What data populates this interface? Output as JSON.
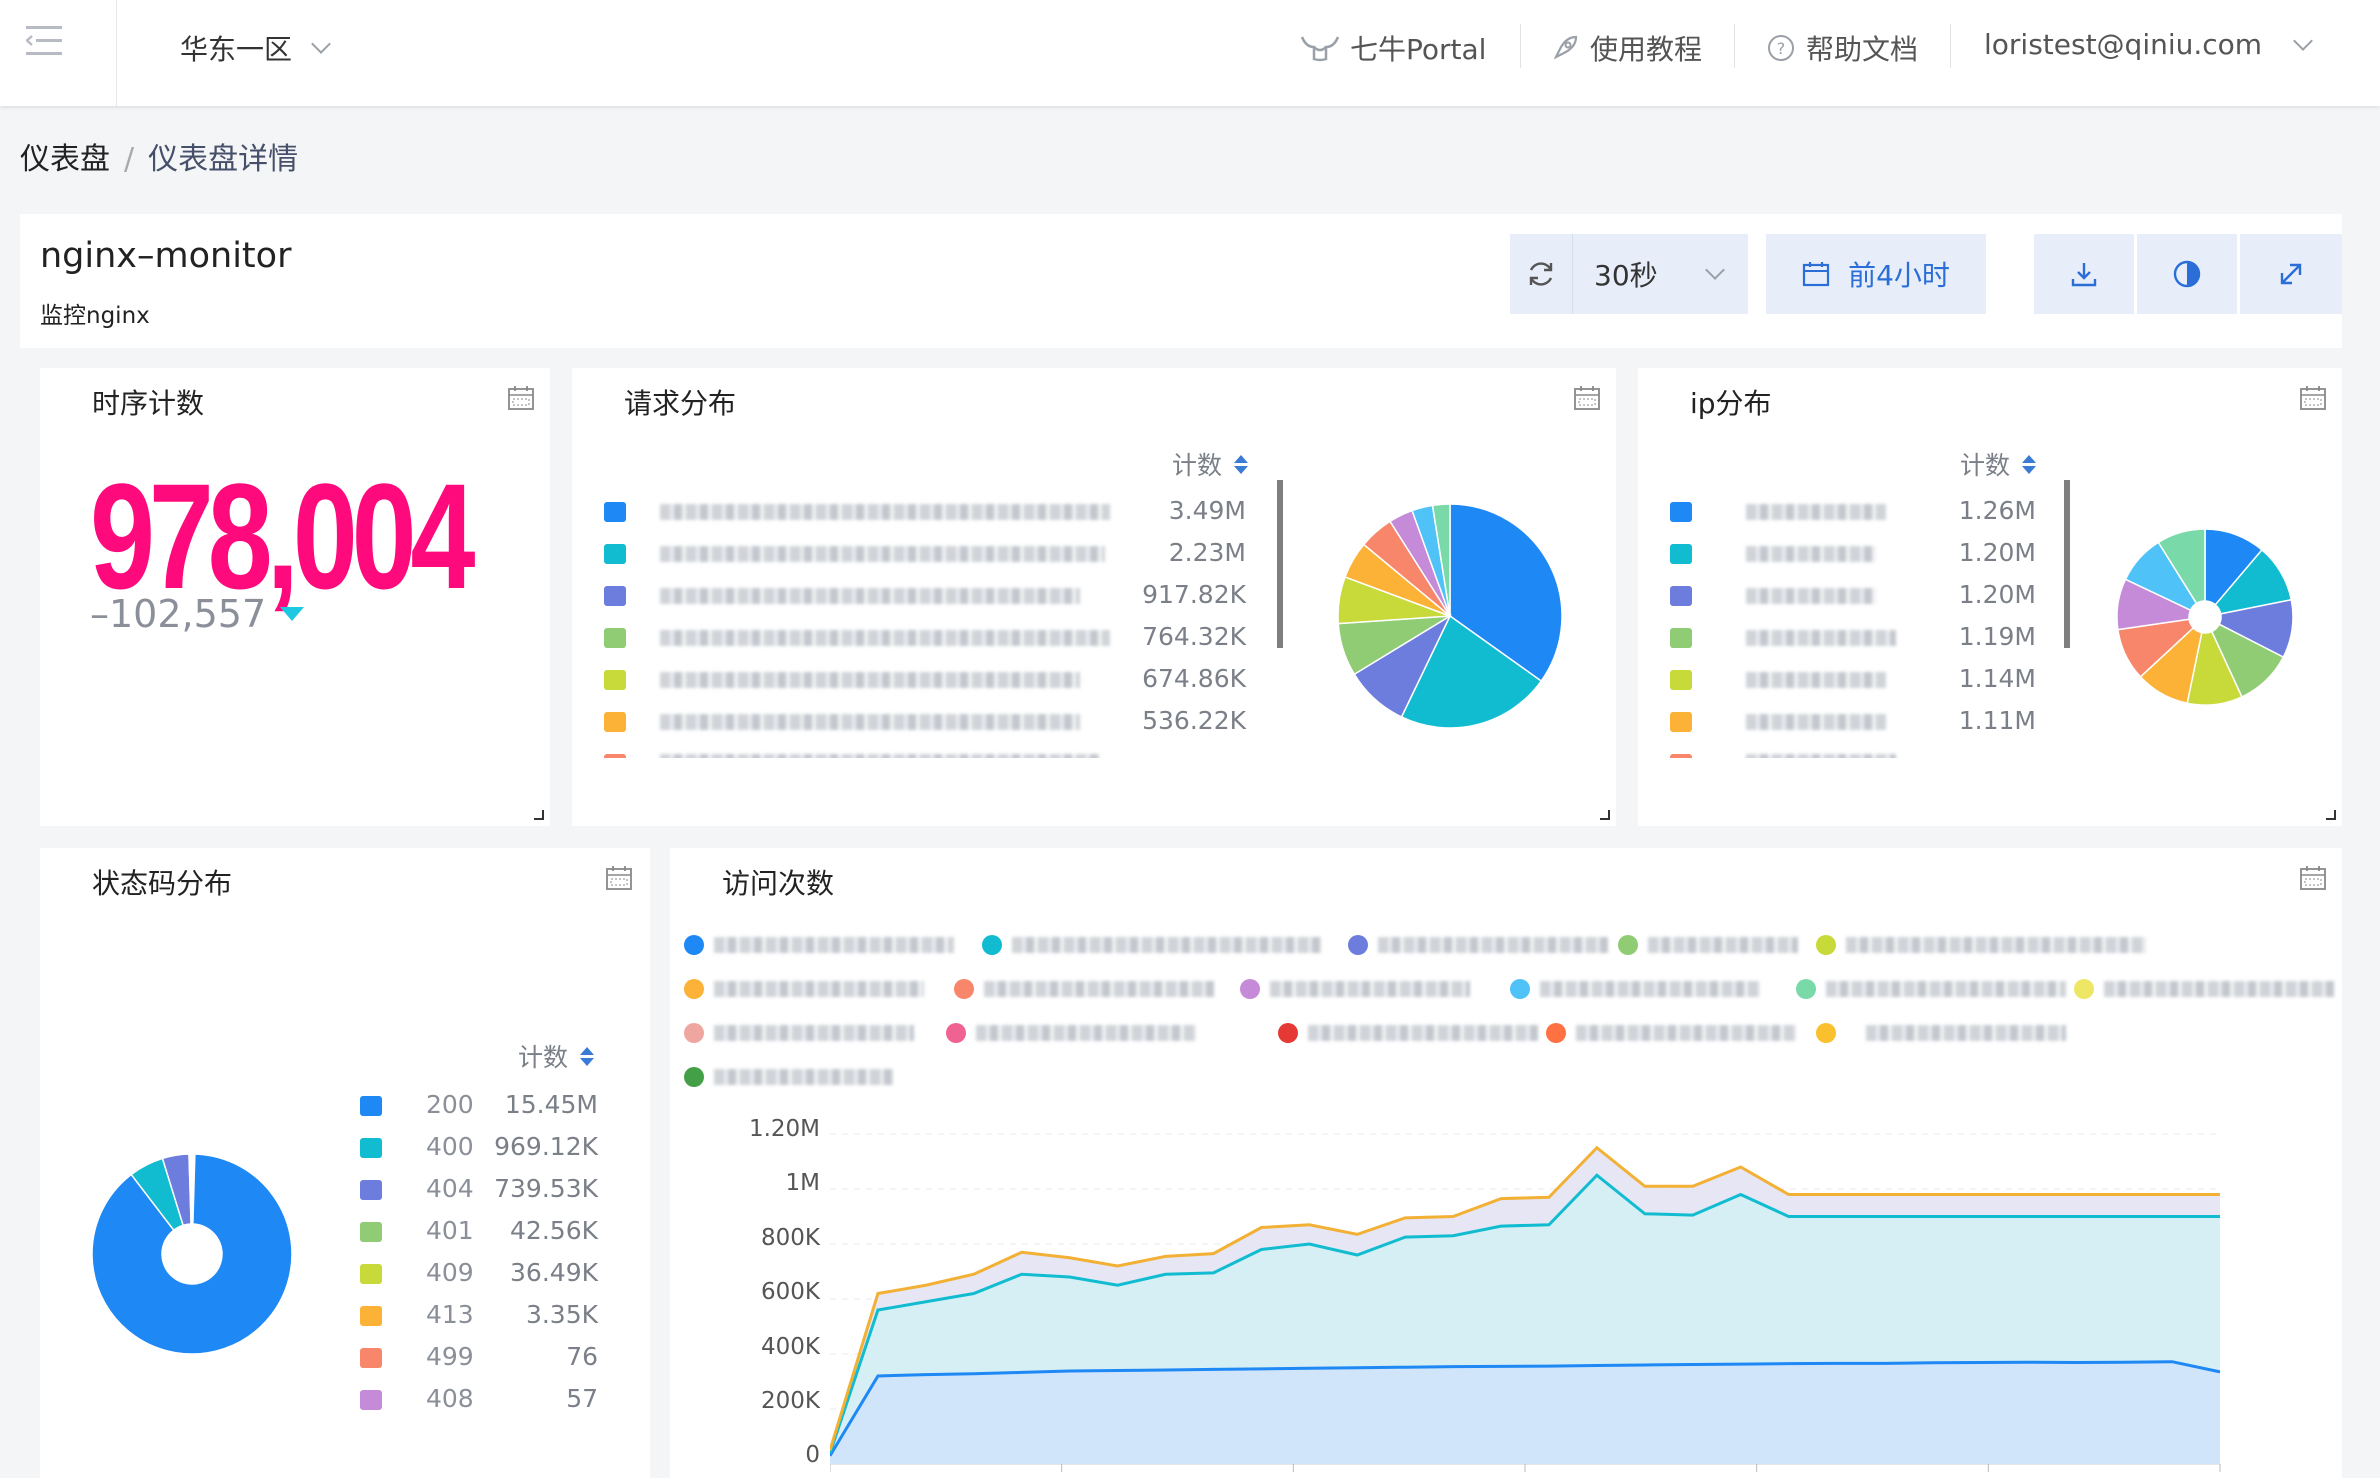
{
  "topbar": {
    "region": "华东一区",
    "portal": "七牛Portal",
    "tutorial": "使用教程",
    "help": "帮助文档",
    "user": "loristest@qiniu.com"
  },
  "breadcrumb": {
    "root": "仪表盘",
    "current": "仪表盘详情"
  },
  "dashboard": {
    "title": "nginx–monitor",
    "subtitle": "监控nginx",
    "refresh_interval": "30秒",
    "time_range": "前4小时"
  },
  "panels": {
    "timeseries_count": {
      "title": "时序计数",
      "value": "978,004",
      "delta": "–102,557",
      "trend": "down"
    },
    "request_dist": {
      "title": "请求分布",
      "count_header": "计数",
      "values": [
        "3.49M",
        "2.23M",
        "917.82K",
        "764.32K",
        "674.86K",
        "536.22K"
      ],
      "colors": [
        "#1e88f5",
        "#11bcd0",
        "#6d7ddd",
        "#8fcc74",
        "#c8d93a",
        "#fbb236"
      ]
    },
    "ip_dist": {
      "title": "ip分布",
      "count_header": "计数",
      "values": [
        "1.26M",
        "1.20M",
        "1.20M",
        "1.19M",
        "1.14M",
        "1.11M"
      ],
      "colors": [
        "#1e88f5",
        "#11bcd0",
        "#6d7ddd",
        "#8fcc74",
        "#c8d93a",
        "#fbb236"
      ]
    },
    "status_dist": {
      "title": "状态码分布",
      "count_header": "计数",
      "rows": [
        {
          "code": "200",
          "count": "15.45M",
          "color": "#1e88f5"
        },
        {
          "code": "400",
          "count": "969.12K",
          "color": "#11bcd0"
        },
        {
          "code": "404",
          "count": "739.53K",
          "color": "#6d7ddd"
        },
        {
          "code": "401",
          "count": "42.56K",
          "color": "#8fcc74"
        },
        {
          "code": "409",
          "count": "36.49K",
          "color": "#c8d93a"
        },
        {
          "code": "413",
          "count": "3.35K",
          "color": "#fbb236"
        },
        {
          "code": "499",
          "count": "76",
          "color": "#f7866a"
        },
        {
          "code": "408",
          "count": "57",
          "color": "#c58bd9"
        }
      ]
    },
    "visits": {
      "title": "访问次数",
      "y_ticks": [
        "1.20M",
        "1M",
        "800K",
        "600K",
        "400K",
        "200K",
        "0"
      ]
    }
  },
  "chart_data": [
    {
      "type": "pie",
      "title": "请求分布",
      "categories": [
        "",
        "",
        "",
        "",
        "",
        "",
        "",
        "",
        "",
        ""
      ],
      "values": [
        3.49,
        2.23,
        0.918,
        0.764,
        0.675,
        0.536,
        0.5,
        0.35,
        0.3,
        0.25
      ],
      "colors": [
        "#1e88f5",
        "#11bcd0",
        "#6d7ddd",
        "#8fcc74",
        "#c8d93a",
        "#fbb236",
        "#f7866a",
        "#c58bd9",
        "#4fc3f7",
        "#7ad9a8"
      ]
    },
    {
      "type": "pie",
      "title": "ip分布",
      "categories": [
        "",
        "",
        "",
        "",
        "",
        "",
        "",
        "",
        "",
        ""
      ],
      "values": [
        1.26,
        1.2,
        1.2,
        1.19,
        1.14,
        1.11,
        1.08,
        1.05,
        1.02,
        1.0
      ],
      "colors": [
        "#1e88f5",
        "#11bcd0",
        "#6d7ddd",
        "#8fcc74",
        "#c8d93a",
        "#fbb236",
        "#f7866a",
        "#c58bd9",
        "#4fc3f7",
        "#7ad9a8"
      ]
    },
    {
      "type": "pie",
      "title": "状态码分布",
      "categories": [
        "200",
        "400",
        "404",
        "401",
        "409",
        "413",
        "499",
        "408"
      ],
      "values": [
        15.45,
        0.969,
        0.7395,
        0.04256,
        0.03649,
        0.00335,
        7.6e-05,
        5.7e-05
      ],
      "colors": [
        "#1e88f5",
        "#11bcd0",
        "#6d7ddd",
        "#8fcc74",
        "#c8d93a",
        "#fbb236",
        "#f7866a",
        "#c58bd9"
      ]
    },
    {
      "type": "area",
      "title": "访问次数",
      "ylim": [
        0,
        1200000
      ],
      "x": [
        0,
        1,
        2,
        3,
        4,
        5,
        6,
        7,
        8,
        9,
        10,
        11,
        12,
        13,
        14,
        15,
        16,
        17,
        18,
        19,
        20,
        21,
        22,
        23,
        24,
        25,
        26,
        27,
        28,
        29
      ],
      "series": [
        {
          "color": "#1e88f5",
          "values": [
            30000,
            320000,
            325000,
            328000,
            333000,
            338000,
            340000,
            342000,
            344000,
            346000,
            348000,
            350000,
            352000,
            354000,
            355000,
            356000,
            358000,
            360000,
            362000,
            363000,
            365000,
            366000,
            366000,
            368000,
            369000,
            370000,
            369000,
            370000,
            372000,
            335000
          ]
        },
        {
          "color": "#11bcd0",
          "values": [
            40000,
            560000,
            590000,
            620000,
            690000,
            680000,
            650000,
            690000,
            695000,
            780000,
            800000,
            760000,
            825000,
            830000,
            865000,
            870000,
            1050000,
            910000,
            905000,
            980000,
            900000,
            900000,
            900000,
            900000,
            900000,
            900000,
            900000,
            900000,
            900000,
            900000
          ]
        },
        {
          "color": "#f2b035",
          "values": [
            50000,
            620000,
            650000,
            690000,
            770000,
            750000,
            720000,
            755000,
            765000,
            860000,
            870000,
            835000,
            895000,
            900000,
            965000,
            970000,
            1150000,
            1010000,
            1010000,
            1080000,
            980000,
            980000,
            980000,
            980000,
            980000,
            980000,
            980000,
            980000,
            980000,
            980000
          ]
        }
      ]
    }
  ],
  "visit_legend_colors": [
    "#1e88f5",
    "#11bcd0",
    "#6d7ddd",
    "#8fcc74",
    "#c8d93a",
    "#fbb236",
    "#f7866a",
    "#c58bd9",
    "#4fc3f7",
    "#7ad9a8",
    "#eee665",
    "#f0a6a0",
    "#f06292",
    "#e53935",
    "#ff7043",
    "#fbc02d",
    "#43a047"
  ]
}
